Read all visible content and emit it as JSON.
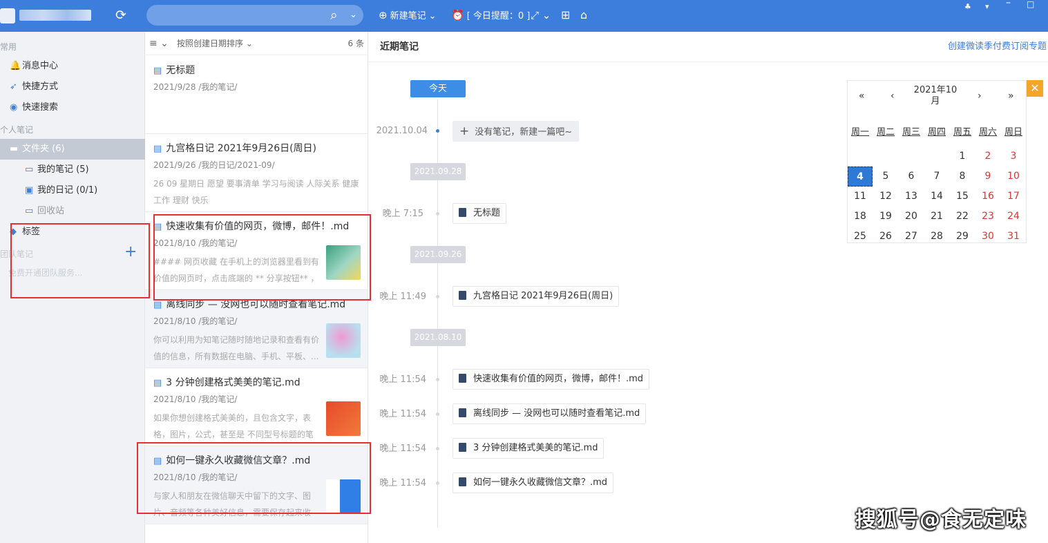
{
  "topbar": {
    "new_note": "新建笔记",
    "reminder": "[ 今日提醒：0 ]"
  },
  "sidebar": {
    "common_header": "常用",
    "message_center": "消息中心",
    "shortcuts": "快捷方式",
    "quick_search": "快速搜索",
    "personal_header": "个人笔记",
    "folders": "文件夹 (6)",
    "my_notes": "我的笔记 (5)",
    "my_diary": "我的日记 (0/1)",
    "recycle_bin": "回收站",
    "tags": "标签",
    "team_header": "团队笔记",
    "free_team": "免费开通团队服务..."
  },
  "list": {
    "sort_label": "按照创建日期排序",
    "count": "6 条",
    "notes": [
      {
        "title": "无标题",
        "meta": "2021/9/28  /我的笔记/",
        "snippet": ""
      },
      {
        "title": "九宫格日记 2021年9月26日(周日)",
        "meta": "2021/9/26  /我的日记/2021-09/",
        "snippet": "26 09 星期日 愿望 要事清单 学习与阅读 人际关系 健康 工作 理财 快乐"
      },
      {
        "title": "快速收集有价值的网页，微博，邮件！.md",
        "meta": "2021/8/10  /我的笔记/",
        "snippet": "#### 网页收藏 在手机上的浏览器里看到有价值的网页时，点击底端的 ** 分享按钮** ，选..."
      },
      {
        "title": "离线同步 — 没网也可以随时查看笔记.md",
        "meta": "2021/8/10  /我的笔记/",
        "snippet": "你可以利用为知笔记随时随地记录和查看有价值的信息，所有数据在电脑、手机、平板、..."
      },
      {
        "title": "3 分钟创建格式美美的笔记.md",
        "meta": "2021/8/10  /我的笔记/",
        "snippet": "如果你想创建格式美美的，且包含文字，表格，图片，公式，甚至是 不同型号标题的笔记..."
      },
      {
        "title": "如何一键永久收藏微信文章？.md",
        "meta": "2021/8/10  /我的笔记/",
        "snippet": "与家人和朋友在微信聊天中留下的文字、图片、音频等各种美好信息，需要保存起来收好？..."
      }
    ]
  },
  "main": {
    "title": "近期笔记",
    "subscribe_link": "创建微读季付费订阅专题",
    "today_label": "今天",
    "today_date": "2021.10.04",
    "new_prompt": "没有笔记，新建一篇吧~",
    "groups": [
      {
        "date": "2021.09.28",
        "time": "晚上 7:15",
        "title": "无标题"
      },
      {
        "date": "2021.09.26",
        "time": "晚上 11:49",
        "title": "九宫格日记 2021年9月26日(周日)"
      },
      {
        "date": "2021.08.10",
        "time": "晚上 11:54",
        "title": "快速收集有价值的网页，微博，邮件！.md"
      }
    ],
    "extra_items": [
      {
        "time": "晚上 11:54",
        "title": "离线同步 — 没网也可以随时查看笔记.md"
      },
      {
        "time": "晚上 11:54",
        "title": "3 分钟创建格式美美的笔记.md"
      },
      {
        "time": "晚上 11:54",
        "title": "如何一键永久收藏微信文章？.md"
      }
    ]
  },
  "calendar": {
    "nav_prev_year": "«",
    "nav_prev_month": "‹",
    "caption": "2021年10月",
    "nav_next_month": "›",
    "nav_next_year": "»",
    "weekdays": [
      "周一",
      "周二",
      "周三",
      "周四",
      "周五",
      "周六",
      "周日"
    ],
    "selected_day": "4",
    "rows": [
      [
        "",
        "",
        "",
        "",
        "1",
        "2",
        "3"
      ],
      [
        "4",
        "5",
        "6",
        "7",
        "8",
        "9",
        "10"
      ],
      [
        "11",
        "12",
        "13",
        "14",
        "15",
        "16",
        "17"
      ],
      [
        "18",
        "19",
        "20",
        "21",
        "22",
        "23",
        "24"
      ],
      [
        "25",
        "26",
        "27",
        "28",
        "29",
        "30",
        "31"
      ]
    ],
    "close": "✕"
  },
  "watermark": "搜狐号@食无定味",
  "colors": {
    "accent": "#3d7ddc",
    "weekend": "#d93636",
    "highlight_box": "#e63030"
  }
}
